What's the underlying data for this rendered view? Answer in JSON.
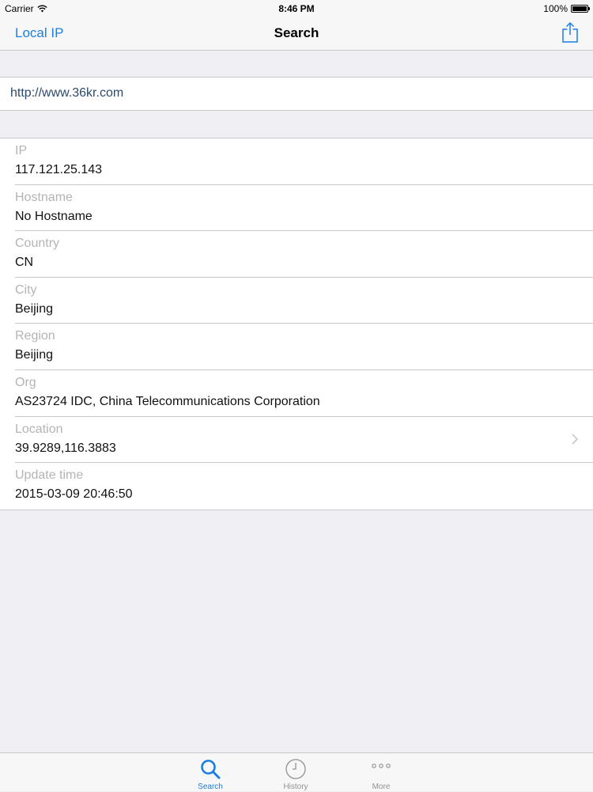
{
  "status_bar": {
    "carrier": "Carrier",
    "time": "8:46 PM",
    "battery": "100%"
  },
  "nav": {
    "left_button": "Local IP",
    "title": "Search",
    "share_icon": "share-icon"
  },
  "search": {
    "url": "http://www.36kr.com"
  },
  "details": [
    {
      "label": "IP",
      "value": "117.121.25.143"
    },
    {
      "label": "Hostname",
      "value": "No Hostname"
    },
    {
      "label": "Country",
      "value": "CN"
    },
    {
      "label": "City",
      "value": "Beijing"
    },
    {
      "label": "Region",
      "value": "Beijing"
    },
    {
      "label": "Org",
      "value": "AS23724 IDC, China Telecommunications Corporation"
    },
    {
      "label": "Location",
      "value": "39.9289,116.3883",
      "disclosure": true
    },
    {
      "label": "Update time",
      "value": "2015-03-09 20:46:50"
    }
  ],
  "tabs": [
    {
      "label": "Search",
      "icon": "search-icon",
      "active": true
    },
    {
      "label": "History",
      "icon": "clock-icon",
      "active": false
    },
    {
      "label": "More",
      "icon": "more-icon",
      "active": false
    }
  ],
  "colors": {
    "accent": "#1a7fe0",
    "background": "#efeff4",
    "separator": "#c8c7cc",
    "label_gray": "#b4b4b8"
  }
}
